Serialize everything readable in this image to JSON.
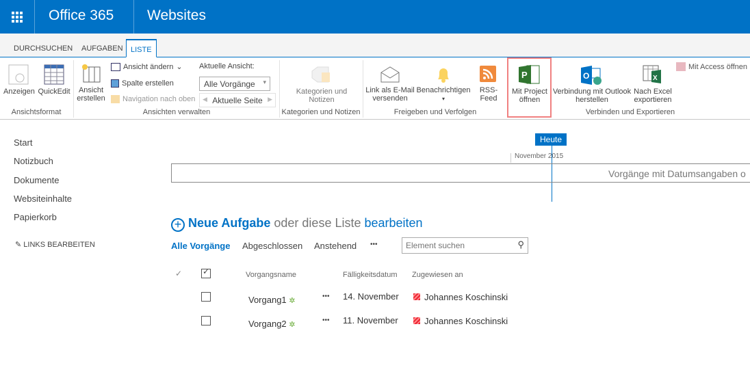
{
  "topbar": {
    "app": "Office 365",
    "site": "Websites"
  },
  "tabs": [
    "DURCHSUCHEN",
    "AUFGABEN",
    "LISTE"
  ],
  "ribbon": {
    "anzeigen": "Anzeigen",
    "quickedit": "QuickEdit",
    "group_format": "Ansichtsformat",
    "ansicht_erstellen": "Ansicht erstellen",
    "ansicht_aendern": "Ansicht ändern",
    "spalte_erstellen": "Spalte erstellen",
    "navigation": "Navigation nach oben",
    "aktuelle_ansicht_label": "Aktuelle Ansicht:",
    "aktuelle_ansicht_value": "Alle Vorgänge",
    "aktuelle_seite": "Aktuelle Seite",
    "group_ansichten": "Ansichten verwalten",
    "kategorien": "Kategorien und Notizen",
    "group_kategorien": "Kategorien und Notizen",
    "email": "Link als E-Mail versenden",
    "benachrichtigen": "Benachrichtigen",
    "rss": "RSS-Feed",
    "group_freigeben": "Freigeben und Verfolgen",
    "project": "Mit Project öffnen",
    "outlook": "Verbindung mit Outlook herstellen",
    "excel": "Nach Excel exportieren",
    "access": "Mit Access öffnen",
    "group_verbinden": "Verbinden und Exportieren"
  },
  "nav": [
    "Start",
    "Notizbuch",
    "Dokumente",
    "Websiteinhalte",
    "Papierkorb"
  ],
  "edit_links": "LINKS BEARBEITEN",
  "timeline": {
    "today": "Heute",
    "month": "November 2015",
    "placeholder": "Vorgänge mit Datumsangaben o"
  },
  "list": {
    "new": "Neue Aufgabe",
    "or": "oder diese Liste",
    "edit": "bearbeiten",
    "views": [
      "Alle Vorgänge",
      "Abgeschlossen",
      "Anstehend"
    ],
    "more": "•••",
    "search_placeholder": "Element suchen",
    "columns": [
      "Vorgangsname",
      "Fälligkeitsdatum",
      "Zugewiesen an"
    ],
    "rows": [
      {
        "name": "Vorgang1",
        "date": "14. November",
        "assigned": "Johannes Koschinski"
      },
      {
        "name": "Vorgang2",
        "date": "11. November",
        "assigned": "Johannes Koschinski"
      }
    ]
  },
  "colors": {
    "accent": "#0072c6",
    "highlight": "#f08080"
  }
}
